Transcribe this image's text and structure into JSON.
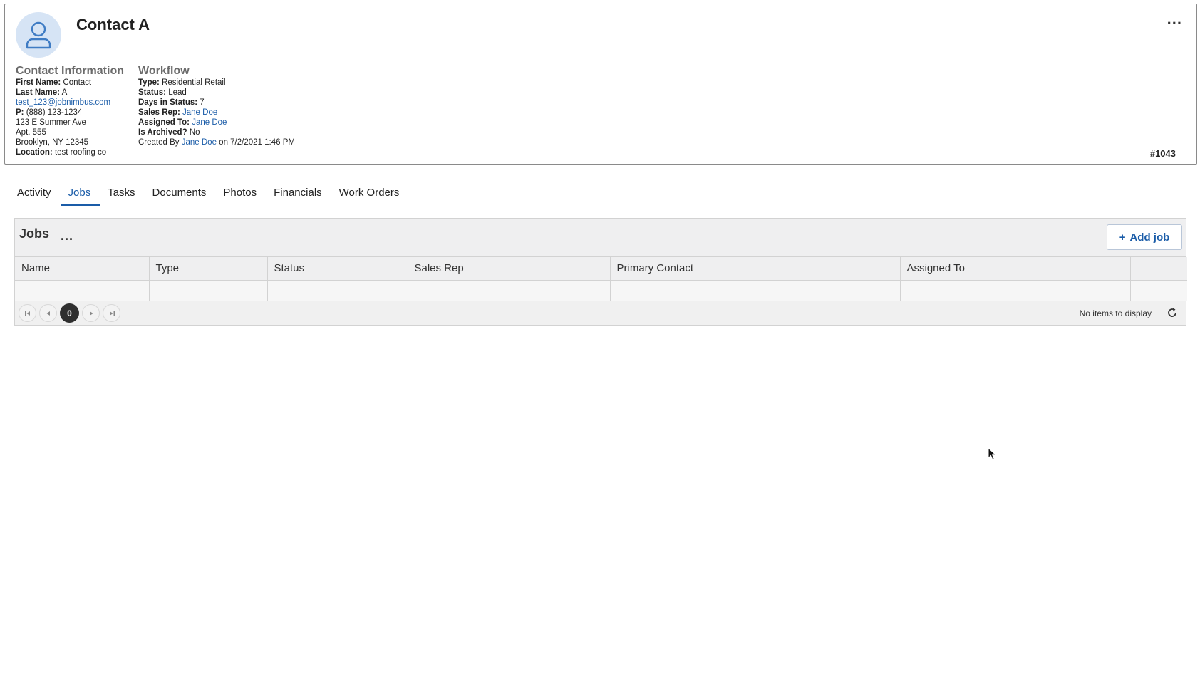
{
  "contact": {
    "name": "Contact A",
    "record_number": "#1043",
    "info_heading": "Contact Information",
    "first_name_label": "First Name:",
    "first_name": "Contact",
    "last_name_label": "Last Name:",
    "last_name": "A",
    "email": "test_123@jobnimbus.com",
    "phone_label": "P:",
    "phone": "(888) 123-1234",
    "address_line1": "123 E Summer Ave",
    "address_line2": "Apt. 555",
    "address_line3": "Brooklyn, NY 12345",
    "location_label": "Location:",
    "location": "test roofing co"
  },
  "workflow": {
    "heading": "Workflow",
    "type_label": "Type:",
    "type": "Residential Retail",
    "status_label": "Status:",
    "status": "Lead",
    "days_label": "Days in Status:",
    "days": "7",
    "sales_rep_label": "Sales Rep:",
    "sales_rep": "Jane Doe",
    "assigned_label": "Assigned To:",
    "assigned": "Jane Doe",
    "archived_label": "Is Archived?",
    "archived": "No",
    "created_prefix": "Created By",
    "created_by": "Jane Doe",
    "created_suffix": "on 7/2/2021 1:46 PM"
  },
  "card_menu_label": "...",
  "tabs": [
    {
      "label": "Activity"
    },
    {
      "label": "Jobs"
    },
    {
      "label": "Tasks"
    },
    {
      "label": "Documents"
    },
    {
      "label": "Photos"
    },
    {
      "label": "Financials"
    },
    {
      "label": "Work Orders"
    }
  ],
  "active_tab": "Jobs",
  "jobs": {
    "title": "Jobs",
    "menu_label": "...",
    "add_button_label": "Add job",
    "add_button_icon": "+",
    "columns": [
      "Name",
      "Type",
      "Status",
      "Sales Rep",
      "Primary Contact",
      "Assigned To",
      ""
    ],
    "current_page": "0",
    "empty_message": "No items to display"
  },
  "colors": {
    "accent": "#1a5ca8",
    "avatar_bg": "#d6e4f5",
    "panel_bg": "#f0f0f0"
  }
}
